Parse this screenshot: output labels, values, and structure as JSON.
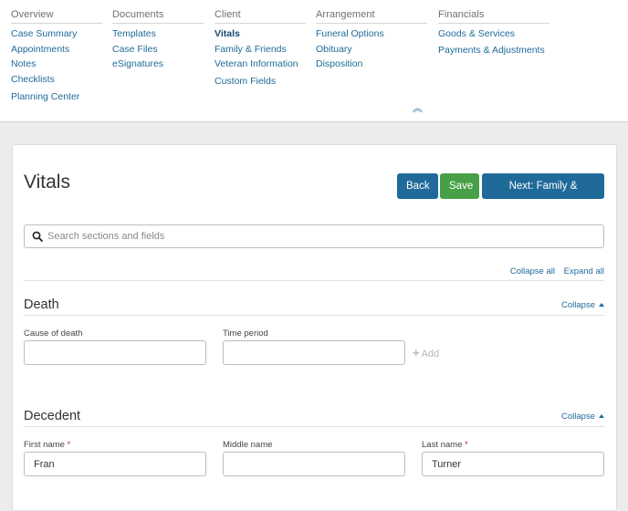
{
  "nav": {
    "columns": [
      {
        "heading": "Overview",
        "links": [
          "Case Summary",
          "Appointments",
          "Notes",
          "Checklists",
          "Planning Center"
        ]
      },
      {
        "heading": "Documents",
        "links": [
          "Templates",
          "Case Files",
          "eSignatures"
        ]
      },
      {
        "heading": "Client",
        "links": [
          "Vitals",
          "Family & Friends",
          "Veteran Information",
          "Custom Fields"
        ]
      },
      {
        "heading": "Arrangement",
        "links": [
          "Funeral Options",
          "Obituary",
          "Disposition"
        ]
      },
      {
        "heading": "Financials",
        "links": [
          "Goods & Services",
          "Payments & Adjustments"
        ]
      }
    ],
    "active": "Vitals",
    "collapse_glyph": "︽"
  },
  "page": {
    "title": "Vitals",
    "back_label": "Back",
    "save_label": "Save",
    "next_label": "Next: Family & Friends"
  },
  "search": {
    "placeholder": "Search sections and fields",
    "value": ""
  },
  "toggles": {
    "collapse_all": "Collapse all",
    "expand_all": "Expand all"
  },
  "sections": {
    "death": {
      "title": "Death",
      "collapse_label": "Collapse",
      "cause_label": "Cause of death",
      "cause_value": "",
      "time_label": "Time period",
      "time_value": "",
      "add_label": "Add"
    },
    "decedent": {
      "title": "Decedent",
      "collapse_label": "Collapse",
      "first_label": "First name",
      "first_value": "Fran",
      "middle_label": "Middle name",
      "middle_value": "",
      "last_label": "Last name",
      "last_value": "Turner",
      "required_mark": "*"
    }
  },
  "colors": {
    "primary": "#1f6a99",
    "success": "#47a047",
    "required": "#c9302c"
  }
}
